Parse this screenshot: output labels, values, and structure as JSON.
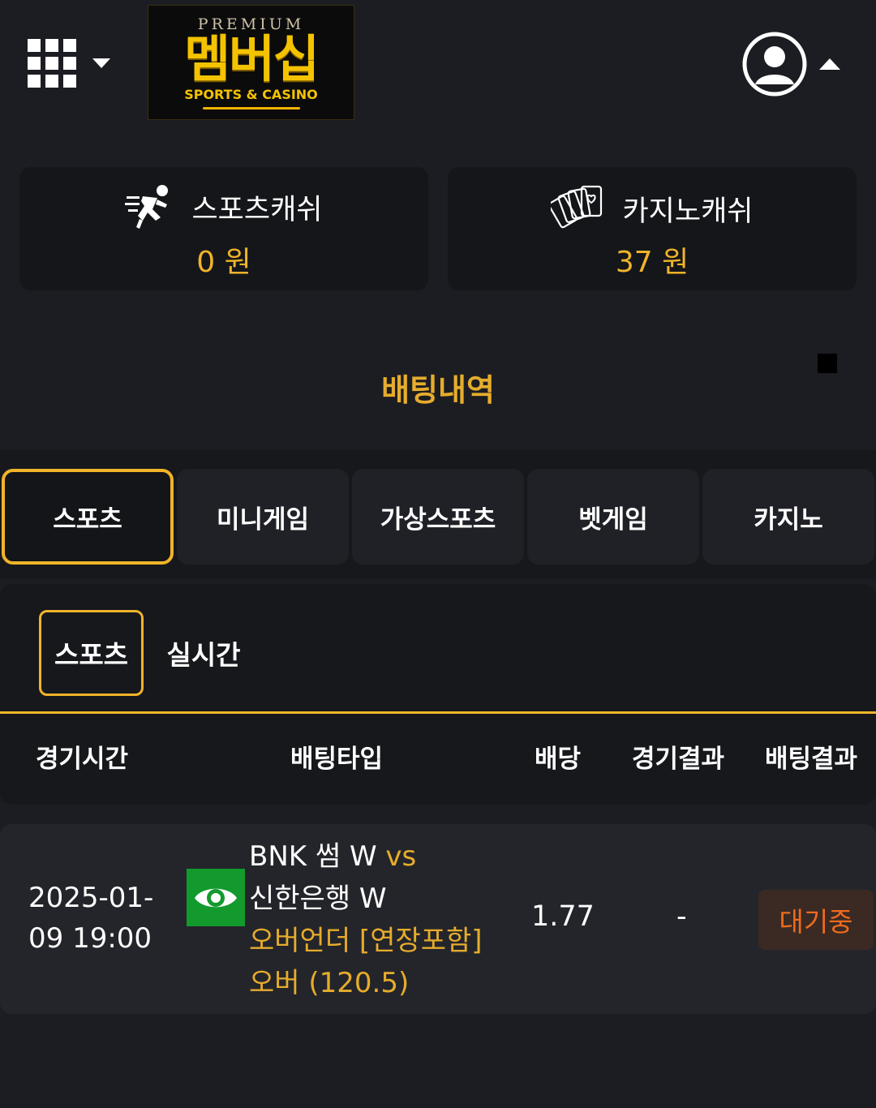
{
  "header": {
    "logo": {
      "premium": "PREMIUM",
      "name": "멤버십",
      "tagline": "SPORTS & CASINO"
    },
    "menu_icon": "grid-menu-icon",
    "user_icon": "user-circle-icon"
  },
  "cash": {
    "sports": {
      "label": "스포츠캐쉬",
      "amount": "0 원",
      "icon": "runner-icon"
    },
    "casino": {
      "label": "카지노캐쉬",
      "amount": "37 원",
      "icon": "cards-icon"
    }
  },
  "section_title": "배팅내역",
  "tabs": [
    {
      "label": "스포츠",
      "active": true
    },
    {
      "label": "미니게임",
      "active": false
    },
    {
      "label": "가상스포츠",
      "active": false
    },
    {
      "label": "벳게임",
      "active": false
    },
    {
      "label": "카지노",
      "active": false
    }
  ],
  "subtabs": [
    {
      "label": "스포츠",
      "active": true
    },
    {
      "label": "실시간",
      "active": false
    }
  ],
  "table": {
    "headers": [
      "경기시간",
      "배팅타입",
      "배당",
      "경기결과",
      "배팅결과"
    ],
    "rows": [
      {
        "time_line1": "2025-01-",
        "time_line2": "09 19:00",
        "home": "BNK 썸 W",
        "vs": "vs",
        "away": "신한은행 W",
        "market": "오버언더 [연장포함]",
        "pick": "오버 (120.5)",
        "odds": "1.77",
        "game_result": "-",
        "bet_result": "대기중"
      }
    ]
  },
  "colors": {
    "accent": "#f0b429",
    "background": "#1c1d22",
    "pending": "#ef6a1f",
    "view_button": "#139a2d"
  }
}
